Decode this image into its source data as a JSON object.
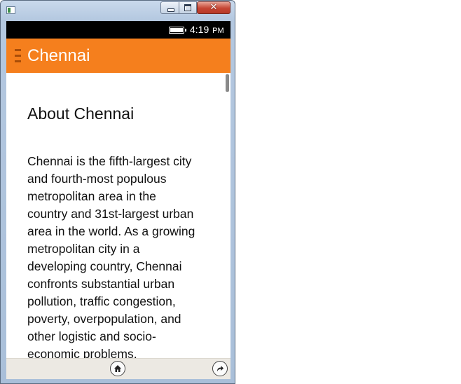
{
  "window": {
    "minimize_label": "",
    "maximize_label": "",
    "close_label": "✕"
  },
  "statusbar": {
    "time": "4:19",
    "ampm": "PM",
    "battery_icon": "battery-full-icon"
  },
  "actionbar": {
    "title": "Chennai",
    "menu_icon": "drawer-menu-icon",
    "background_color": "#f57f1d"
  },
  "content": {
    "heading": "About Chennai",
    "paragraph_lines": [
      "Chennai is the fifth-largest city",
      "and fourth-most populous",
      "metropolitan area in the",
      "country and 31st-largest urban",
      "area in the world. As a growing",
      "metropolitan city in a",
      "developing country, Chennai",
      "confronts substantial urban",
      "pollution, traffic congestion,",
      "poverty, overpopulation, and",
      "other logistic and socio-",
      "economic problems."
    ]
  },
  "bottombar": {
    "home_icon": "home-icon",
    "redo_icon": "redo-icon"
  }
}
